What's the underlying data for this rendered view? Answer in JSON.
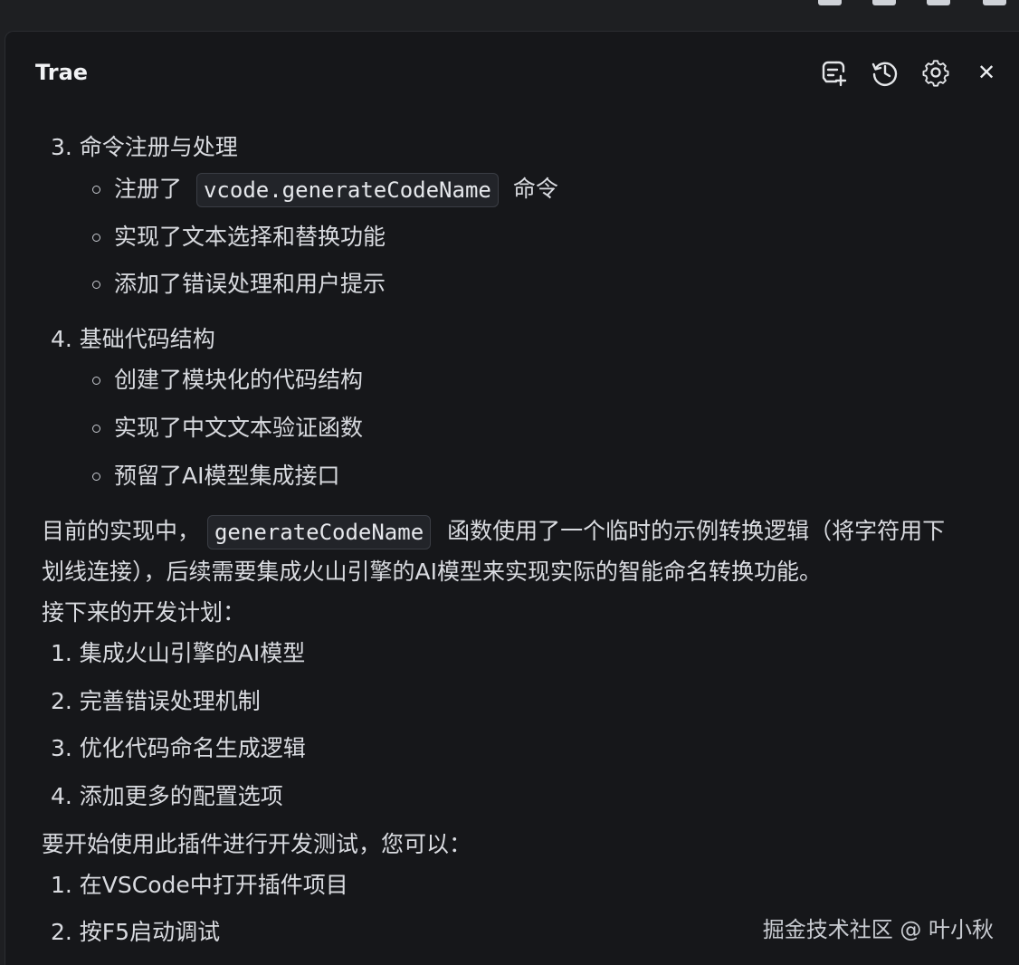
{
  "panel": {
    "title": "Trae",
    "icons": {
      "new_chat": "new-chat-icon",
      "history": "history-icon",
      "settings": "gear-icon",
      "close": "close-icon"
    },
    "close_glyph": "✕"
  },
  "section3": {
    "heading": "3. 命令注册与处理",
    "items": [
      {
        "before": "注册了",
        "code": "vcode.generateCodeName",
        "after": "命令"
      },
      {
        "text": "实现了文本选择和替换功能"
      },
      {
        "text": "添加了错误处理和用户提示"
      }
    ]
  },
  "section4": {
    "heading": "4. 基础代码结构",
    "items": [
      {
        "text": "创建了模块化的代码结构"
      },
      {
        "text": "实现了中文文本验证函数"
      },
      {
        "text": "预留了AI模型集成接口"
      }
    ]
  },
  "summary": {
    "line1_before": "目前的实现中，",
    "line1_code": "generateCodeName",
    "line1_after": "函数使用了一个临时的示例转换逻辑（将字符用下",
    "line2": "划线连接），后续需要集成火山引擎的AI模型来实现实际的智能命名转换功能。"
  },
  "plan": {
    "heading": "接下来的开发计划：",
    "items": [
      "1. 集成火山引擎的AI模型",
      "2. 完善错误处理机制",
      "3. 优化代码命名生成逻辑",
      "4. 添加更多的配置选项"
    ]
  },
  "start": {
    "heading": "要开始使用此插件进行开发测试，您可以：",
    "items": [
      "1. 在VSCode中打开插件项目",
      "2. 按F5启动调试"
    ]
  },
  "watermark": "掘金技术社区 @ 叶小秋"
}
